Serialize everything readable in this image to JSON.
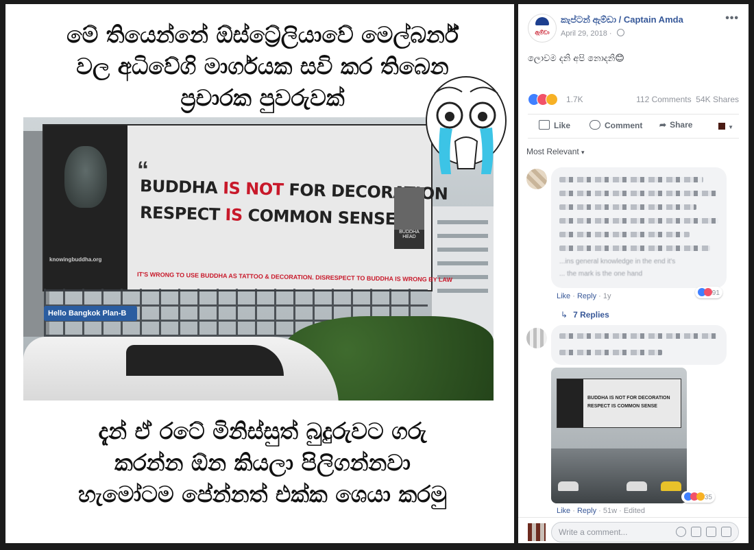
{
  "meme": {
    "top_caption": [
      "මේ තියෙන්නේ ඕස්ට්‍රේලියාවේ මෙල්බර්න්",
      "වල අධිවේගි මාර්ගයක සවි කර තිබෙන",
      "ප්‍රචාරක පුවරුවක්"
    ],
    "bottom_caption": [
      "දැන් ඒ රටේ මිනිස්සුත් බුදුරුවට ගරු",
      "කරන්න ඕන කියලා පිලිගන්නවා",
      "හැමෝටම පේන්නත් එක්ක ශෙයා කරමු"
    ],
    "billboard": {
      "quote_mark": "“",
      "line1": {
        "a": "BUDDHA ",
        "b": "IS NOT",
        "c": " FOR DECORATION"
      },
      "line2": {
        "a": "RESPECT ",
        "b": "IS",
        "c": " COMMON SENSE",
        "d": ",,"
      },
      "footer": "IT'S WRONG TO USE BUDDHA AS TATTOO & DECORATION.  DISRESPECT TO BUDDHA IS WRONG BY LAW",
      "website": "knowingbuddha.org",
      "badge": "BUDDHA HEAD",
      "street_sign": "Hello Bangkok  Plan-B"
    }
  },
  "post": {
    "page_name": "කැප්ටන් ඇම්ඩා / Captain Amda",
    "avatar_text": "ඇම්ඩා",
    "date": "April 29, 2018 · ",
    "more": "•••",
    "text": "ලොවම දනි අපි නොදනි😊",
    "reaction_count": "1.7K",
    "comments_count": "112 Comments",
    "shares_count": "54K Shares",
    "actions": {
      "like": "Like",
      "comment": "Comment",
      "share": "Share"
    },
    "sort_label": "Most Relevant",
    "sort_caret": "▾"
  },
  "comments": [
    {
      "partial_text": "...ins general knowledge in the end it's",
      "partial_text2": "... the mark is the one hand",
      "like": "Like",
      "reply": "Reply",
      "age": "1y",
      "reactions": "91",
      "replies_link": "7 Replies",
      "reply_arrow": "↳"
    },
    {
      "like": "Like",
      "reply": "Reply",
      "age": "51w",
      "edited": "Edited",
      "reactions": "35",
      "image_text_line1": "BUDDHA IS NOT FOR DECORATION",
      "image_text_line2": "RESPECT IS COMMON SENSE"
    }
  ],
  "composer": {
    "placeholder": "Write a comment..."
  },
  "colors": {
    "link": "#365899",
    "accent_red": "#c8192a",
    "like_blue": "#4080ff",
    "love_red": "#f25268",
    "haha_yellow": "#f7b125"
  }
}
